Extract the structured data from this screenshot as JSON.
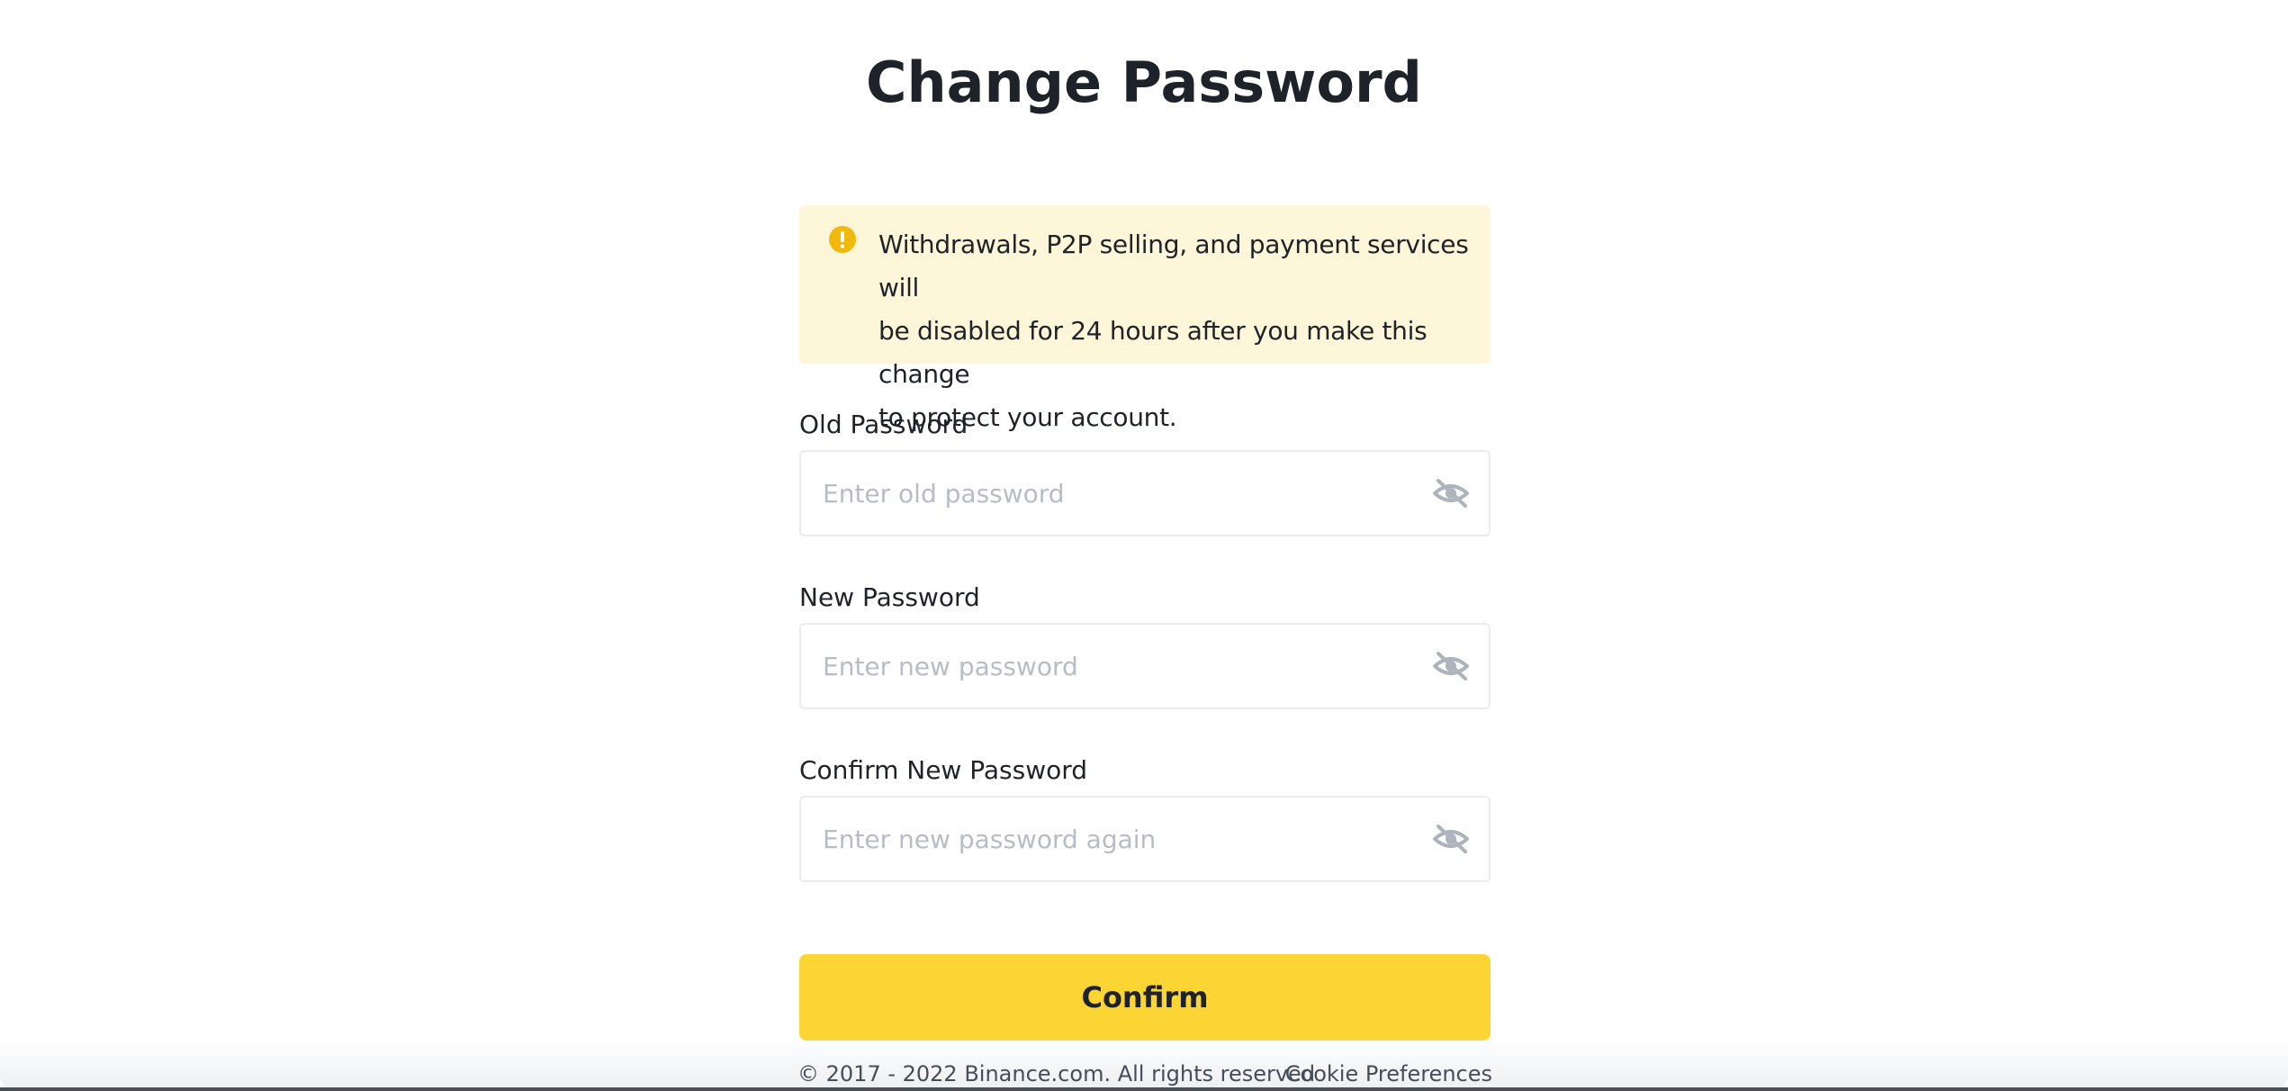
{
  "page": {
    "title": "Change Password"
  },
  "alert": {
    "icon": "warning-circle-icon",
    "line1": "Withdrawals, P2P selling, and payment services will",
    "line2": "be disabled for 24 hours after you make this change",
    "line3": "to protect your account.",
    "icon_color": "#f0b90b",
    "background_color": "#fef6d8"
  },
  "fields": [
    {
      "label": "Old Password",
      "placeholder": "Enter old password",
      "value": "",
      "icon": "eye-hidden-icon"
    },
    {
      "label": "New Password",
      "placeholder": "Enter new password",
      "value": "",
      "icon": "eye-hidden-icon"
    },
    {
      "label": "Confirm New Password",
      "placeholder": "Enter new password again",
      "value": "",
      "icon": "eye-hidden-icon"
    }
  ],
  "confirm": {
    "label": "Confirm",
    "color": "#fcd535"
  },
  "footer": {
    "copyright": "© 2017 - 2022 Binance.com. All rights reserved",
    "cookie_link": "Cookie Preferences"
  }
}
